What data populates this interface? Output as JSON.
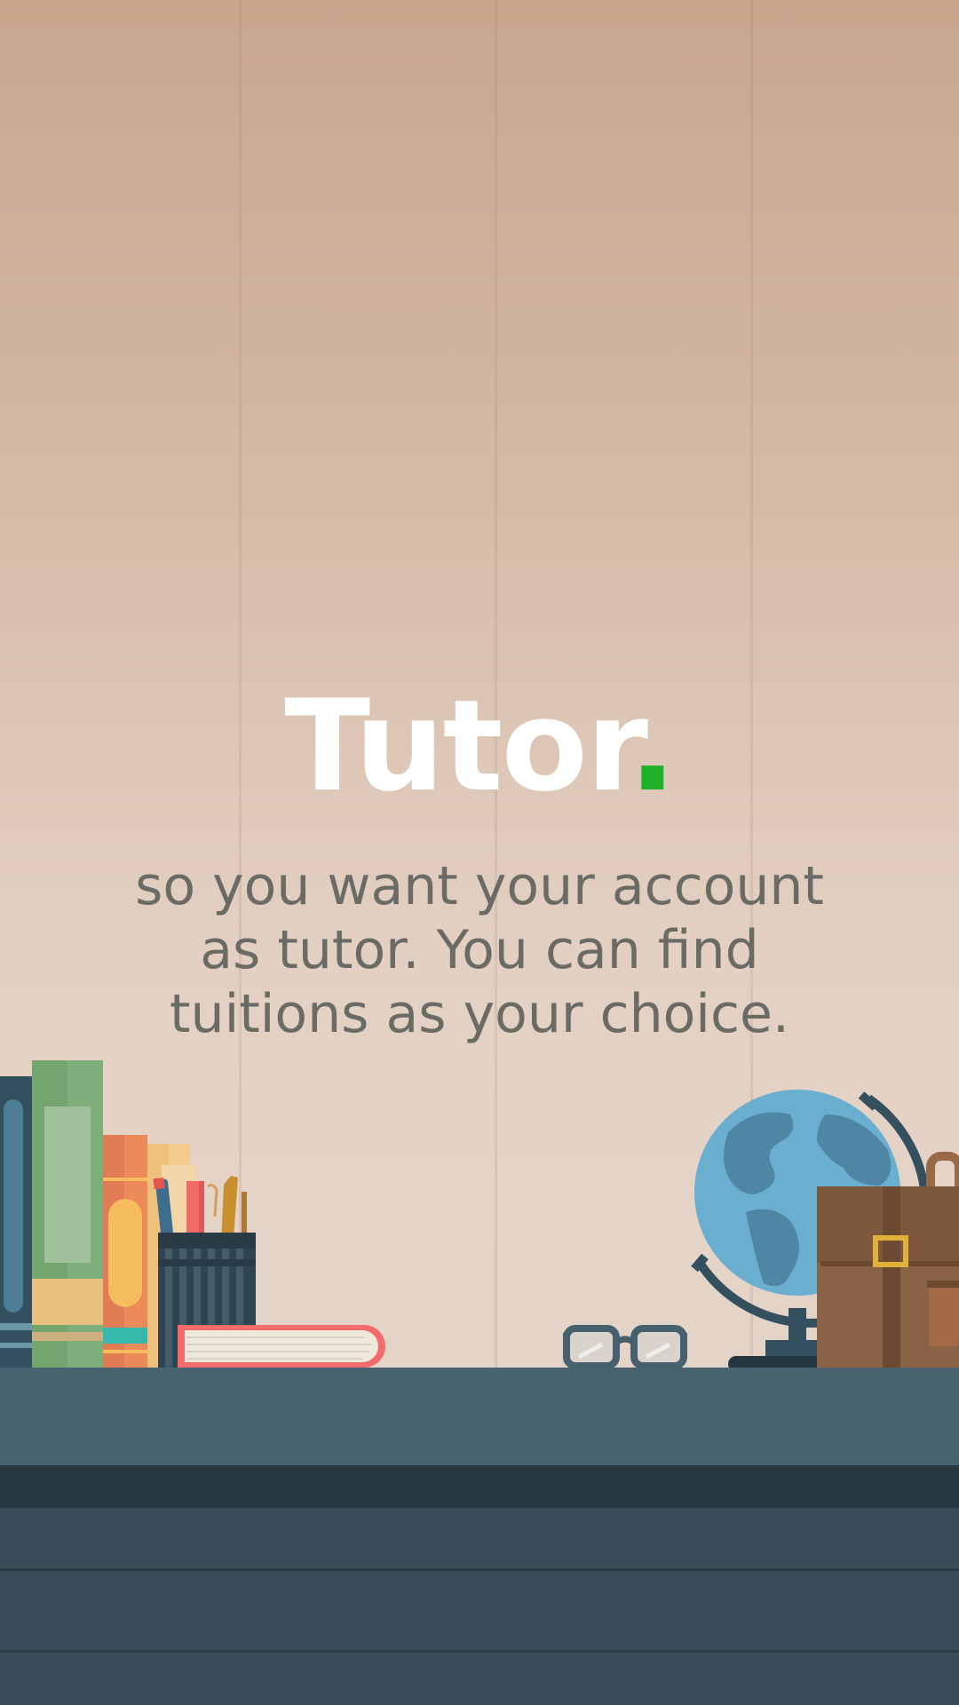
{
  "brand": {
    "name": "Tutor",
    "dot": ".",
    "dot_color": "#1fb12a"
  },
  "tagline": {
    "lines": [
      "so you want your account",
      "as tutor. You can find",
      "tuitions as your choice."
    ]
  },
  "colors": {
    "background_top": "#c7a68c",
    "background_bottom": "#e3d3c7",
    "desk_top": "#48626f",
    "desk_front": "#394c58",
    "text_white": "#ffffff",
    "text_gray": "#6b6b66"
  },
  "illustration": {
    "items": [
      "books-icon",
      "pencil-cup-icon",
      "book-icon",
      "glasses-icon",
      "globe-icon",
      "briefcase-icon"
    ]
  }
}
